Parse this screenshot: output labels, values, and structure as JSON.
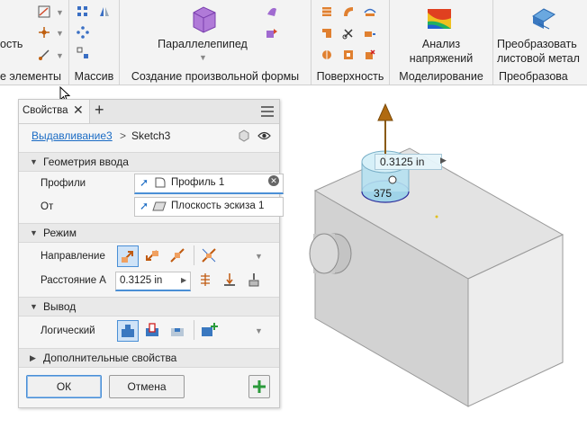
{
  "ribbon": {
    "groups": [
      {
        "label": "е элементы",
        "partial_text": "ость"
      },
      {
        "label": "Массив"
      },
      {
        "label": "Создание произвольной формы",
        "button": "Параллелепипед"
      },
      {
        "label": "Поверхность"
      },
      {
        "label": "Моделирование",
        "button_line1": "Анализ",
        "button_line2": "напряжений"
      },
      {
        "label": "Преобразова",
        "button_line1": "Преобразовать",
        "button_line2": "листовой метал"
      }
    ]
  },
  "panel": {
    "tab_label": "Свойства",
    "breadcrumb_link": "Выдавливание3",
    "breadcrumb_sep": ">",
    "breadcrumb_current": "Sketch3",
    "sections": {
      "input_geometry": "Геометрия ввода",
      "mode": "Режим",
      "output": "Вывод",
      "advanced": "Дополнительные свойства"
    },
    "profiles_label": "Профили",
    "profiles_value": "Профиль 1",
    "from_label": "От",
    "from_value": "Плоскость эскиза 1",
    "direction_label": "Направление",
    "distance_label": "Расстояние A",
    "distance_value": "0.3125 in",
    "boolean_label": "Логический",
    "ok_label": "ОК",
    "cancel_label": "Отмена"
  },
  "viewport": {
    "dimension_value": "0.3125 in",
    "partial_label": "375"
  },
  "colors": {
    "accent": "#1a6bc4",
    "panel_bg": "#f5f5f5",
    "ribbon_bg": "#f3f3f3",
    "arrow": "#b06a10",
    "preview": "#9fd3e8",
    "add_green": "#2a9a3a"
  }
}
